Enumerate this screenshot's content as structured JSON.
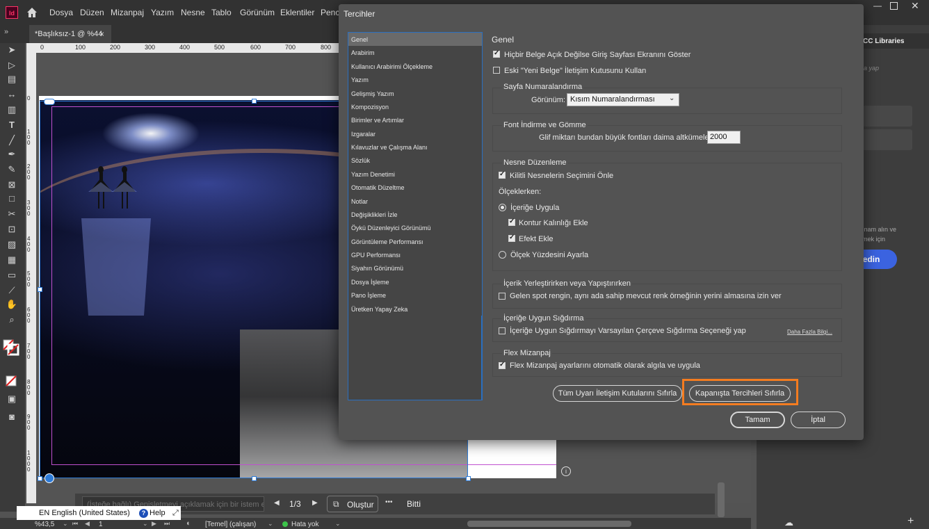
{
  "app": {
    "logo": "Id",
    "menu": [
      "Dosya",
      "Düzen",
      "Mizanpaj",
      "Yazım",
      "Nesne",
      "Tablo",
      "Görünüm",
      "Eklentiler",
      "Pence"
    ],
    "doc_tab": "*Başlıksız-1 @ %44",
    "doc_tab_close": "×"
  },
  "rulers": {
    "h_ticks": [
      "0",
      "100",
      "200",
      "300",
      "400",
      "500",
      "600",
      "700",
      "800"
    ],
    "v_ticks": [
      "0",
      "100",
      "200",
      "300",
      "400",
      "500",
      "600",
      "700",
      "800",
      "900",
      "1000"
    ]
  },
  "prompt": {
    "placeholder": "(İsteğe bağlı) Genişletmeyi açıklamak için bir istem ekleyi",
    "page_counter": "1/3",
    "generate_label": "Oluştur",
    "more": "•••",
    "done_label": "Bitti"
  },
  "status": {
    "zoom": "%43,5",
    "page": "1",
    "style": "[Temel] (çalışan)",
    "errors": "Hata yok",
    "language": "EN English (United States)",
    "help": "Help"
  },
  "right_panel": {
    "title": "CC Libraries",
    "search_hint": "a yap",
    "promo_text_1": "ınam alın ve",
    "promo_text_2": "mek için",
    "promo_button": "şfedin"
  },
  "dialog": {
    "title": "Tercihler",
    "categories": [
      "Genel",
      "Arabirim",
      "Kullanıcı Arabirimi Ölçekleme",
      "Yazım",
      "Gelişmiş Yazım",
      "Kompozisyon",
      "Birimler ve Artımlar",
      "Izgaralar",
      "Kılavuzlar ve Çalışma Alanı",
      "Sözlük",
      "Yazım Denetimi",
      "Otomatik Düzeltme",
      "Notlar",
      "Değişiklikleri İzle",
      "Öykü Düzenleyici Görünümü",
      "Görüntüleme Performansı",
      "GPU Performansı",
      "Siyahın Görünümü",
      "Dosya İşleme",
      "Pano İşleme",
      "Üretken Yapay Zeka"
    ],
    "section_title": "Genel",
    "opt_show_start": "Hiçbir Belge Açık Değilse Giriş Sayfası Ekranını Göster",
    "opt_legacy_new_doc": "Eski \"Yeni Belge\" İletişim Kutusunu Kullan",
    "page_numbering_title": "Sayfa Numaralandırma",
    "view_label": "Görünüm:",
    "view_value": "Kısım Numaralandırması",
    "font_title": "Font İndirme ve Gömme",
    "glyph_label": "Glif miktarı bundan büyük fontları daima altkümele:",
    "glyph_value": "2000",
    "object_edit_title": "Nesne Düzenleme",
    "opt_prevent_locked": "Kilitli Nesnelerin Seçimini Önle",
    "scaling_label": "Ölçeklerken:",
    "opt_apply_content": "İçeriğe Uygula",
    "opt_stroke": "Kontur Kalınlığı Ekle",
    "opt_effect": "Efekt Ekle",
    "opt_adjust_pct": "Ölçek Yüzdesini Ayarla",
    "paste_title": "İçerik Yerleştirirken veya Yapıştırırken",
    "opt_spot": "Gelen spot rengin, aynı ada sahip mevcut renk örneğinin yerini almasına izin ver",
    "fit_title": "İçeriğe Uygun Sığdırma",
    "opt_fit": "İçeriğe Uygun Sığdırmayı Varsayılan Çerçeve Sığdırma Seçeneği yap",
    "more_info": "Daha Fazla Bilgi...",
    "flex_title": "Flex Mizanpaj",
    "opt_flex": "Flex Mizanpaj ayarlarını otomatik olarak algıla ve uygula",
    "btn_reset_warnings": "Tüm Uyarı İletişim Kutularını Sıfırla",
    "btn_reset_prefs": "Kapanışta Tercihleri Sıfırla",
    "btn_ok": "Tamam",
    "btn_cancel": "İptal",
    "highlight_color": "#f47c20"
  }
}
